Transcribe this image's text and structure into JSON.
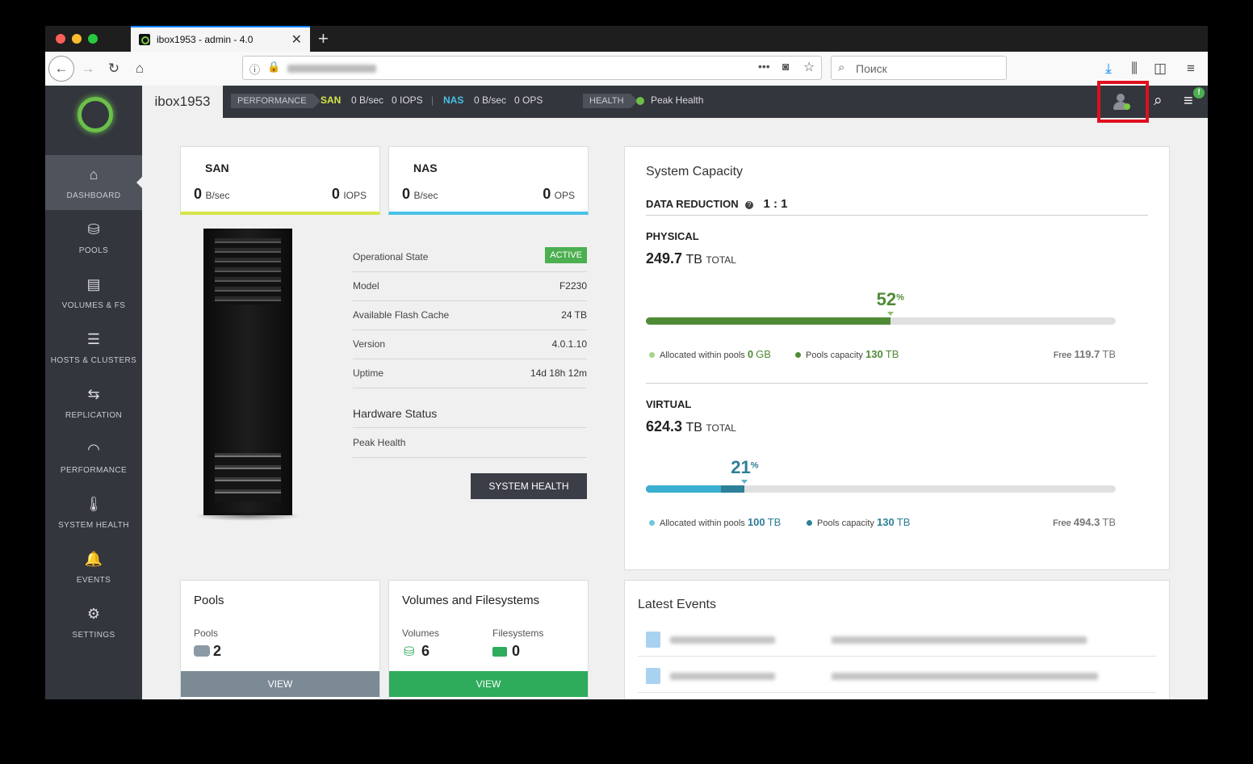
{
  "browser": {
    "tab_title": "ibox1953 - admin - 4.0",
    "search_placeholder": "Поиск"
  },
  "topbar": {
    "system_name": "ibox1953",
    "performance_label": "PERFORMANCE",
    "san_label": "SAN",
    "san_throughput": "0 B/sec",
    "san_iops": "0 IOPS",
    "separator": "|",
    "nas_label": "NAS",
    "nas_throughput": "0 B/sec",
    "nas_ops": "0 OPS",
    "health_label": "HEALTH",
    "health_status": "Peak Health",
    "notification_badge": "!"
  },
  "sidebar": {
    "items": [
      {
        "label": "DASHBOARD",
        "icon": "home-icon",
        "glyph": "⌂"
      },
      {
        "label": "POOLS",
        "icon": "pool-icon",
        "glyph": "⛁"
      },
      {
        "label": "VOLUMES & FS",
        "icon": "volumes-icon",
        "glyph": "▤"
      },
      {
        "label": "HOSTS & CLUSTERS",
        "icon": "hosts-icon",
        "glyph": "☰"
      },
      {
        "label": "REPLICATION",
        "icon": "replication-icon",
        "glyph": "⇆"
      },
      {
        "label": "PERFORMANCE",
        "icon": "gauge-icon",
        "glyph": "◠"
      },
      {
        "label": "SYSTEM HEALTH",
        "icon": "thermometer-icon",
        "glyph": "🌡"
      },
      {
        "label": "EVENTS",
        "icon": "events-icon",
        "glyph": "🔔"
      },
      {
        "label": "SETTINGS",
        "icon": "gear-icon",
        "glyph": "⚙"
      }
    ]
  },
  "san_card": {
    "title": "SAN",
    "throughput_value": "0",
    "throughput_unit": "B/sec",
    "iops_value": "0",
    "iops_unit": "IOPS"
  },
  "nas_card": {
    "title": "NAS",
    "throughput_value": "0",
    "throughput_unit": "B/sec",
    "ops_value": "0",
    "ops_unit": "OPS"
  },
  "system_info": {
    "rows": [
      {
        "key": "Operational State",
        "value": "ACTIVE"
      },
      {
        "key": "Model",
        "value": "F2230"
      },
      {
        "key": "Available Flash Cache",
        "value": "24 TB"
      },
      {
        "key": "Version",
        "value": "4.0.1.10"
      },
      {
        "key": "Uptime",
        "value": "14d 18h 12m"
      }
    ],
    "hardware_status_title": "Hardware Status",
    "hardware_status_value": "Peak Health",
    "system_health_button": "SYSTEM HEALTH"
  },
  "capacity": {
    "title": "System Capacity",
    "data_reduction_label": "DATA REDUCTION",
    "help_icon": "?",
    "data_reduction_value": "1 : 1",
    "physical": {
      "label": "PHYSICAL",
      "total_value": "249.7",
      "total_unit": "TB",
      "total_suffix": "TOTAL",
      "percent": "52",
      "percent_sign": "%",
      "allocated_label": "Allocated within pools",
      "allocated_value": "0",
      "allocated_unit": "GB",
      "pools_label": "Pools capacity",
      "pools_value": "130",
      "pools_unit": "TB",
      "free_label": "Free",
      "free_value": "119.7",
      "free_unit": "TB",
      "fill_fraction": 0.52,
      "color": "#4f8b36"
    },
    "virtual": {
      "label": "VIRTUAL",
      "total_value": "624.3",
      "total_unit": "TB",
      "total_suffix": "TOTAL",
      "percent": "21",
      "percent_sign": "%",
      "allocated_label": "Allocated within pools",
      "allocated_value": "100",
      "allocated_unit": "TB",
      "pools_label": "Pools capacity",
      "pools_value": "130",
      "pools_unit": "TB",
      "free_label": "Free",
      "free_value": "494.3",
      "free_unit": "TB",
      "allocated_fraction": 0.16,
      "fill_fraction": 0.21,
      "color": "#2e7f98",
      "light_color": "#39afd1"
    }
  },
  "pools_card": {
    "title": "Pools",
    "label": "Pools",
    "count": "2",
    "button": "VIEW"
  },
  "volumes_card": {
    "title": "Volumes and Filesystems",
    "volumes_label": "Volumes",
    "volumes_count": "6",
    "filesystems_label": "Filesystems",
    "filesystems_count": "0",
    "button": "VIEW"
  },
  "events": {
    "title": "Latest Events"
  },
  "colors": {
    "sidebar_bg": "#33363d",
    "san_accent": "#d7e54a",
    "nas_accent": "#49c0e6",
    "active_badge": "#4caf50",
    "pools_view": "#7b8a95",
    "volumes_view": "#2eab5b",
    "highlight": "#e0101f"
  }
}
